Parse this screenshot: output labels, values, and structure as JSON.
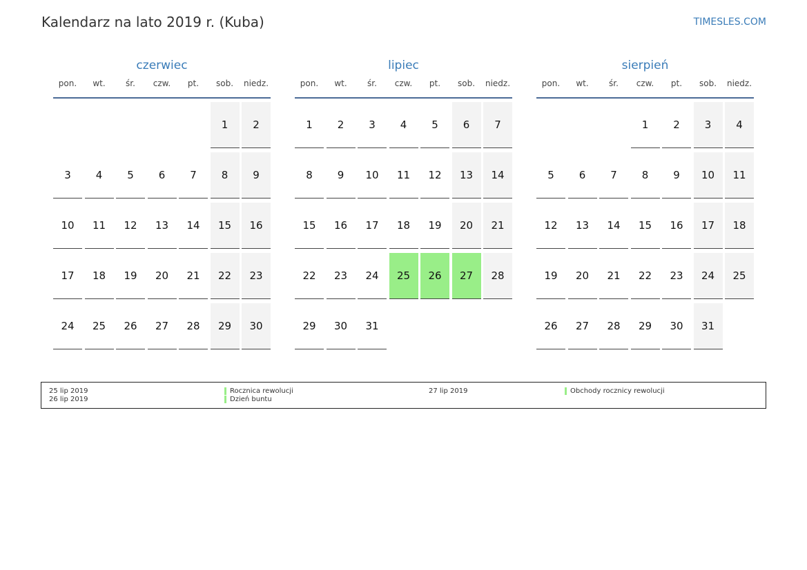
{
  "header": {
    "title": "Kalendarz na lato 2019 r. (Kuba)",
    "site": "TIMESLES.COM"
  },
  "weekdays": [
    "pon.",
    "wt.",
    "śr.",
    "czw.",
    "pt.",
    "sob.",
    "niedz."
  ],
  "months": [
    {
      "name": "czerwiec",
      "offset": 5,
      "days": 30,
      "holidays": []
    },
    {
      "name": "lipiec",
      "offset": 0,
      "days": 31,
      "holidays": [
        25,
        26,
        27
      ]
    },
    {
      "name": "sierpień",
      "offset": 3,
      "days": 31,
      "holidays": []
    }
  ],
  "legend": [
    {
      "date": "25 lip 2019",
      "name": "Rocznica rewolucji"
    },
    {
      "date": "26 lip 2019",
      "name": "Dzień buntu"
    },
    {
      "date": "27 lip 2019",
      "name": "Obchody rocznicy rewolucji"
    }
  ],
  "colors": {
    "holiday": "#99ee88",
    "weekend": "#f3f3f3",
    "accent": "#3a7cb8"
  }
}
